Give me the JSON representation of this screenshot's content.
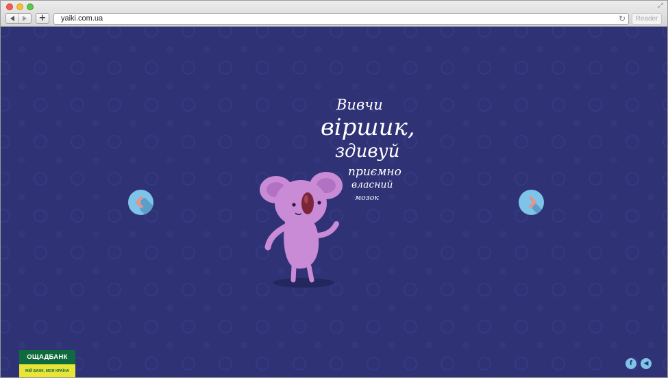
{
  "browser": {
    "url": "yaiki.com.ua",
    "reader_label": "Reader",
    "add_tab_label": "+",
    "reload_glyph": "↻",
    "fullscreen_glyph": "⤢"
  },
  "page": {
    "headline_lines": [
      "Вивчи",
      "віршик,",
      "здивуй",
      "приємно",
      "власний",
      "мозок"
    ],
    "bank_name": "ОЩАДБАНК",
    "bank_slogan": "МІЙ БАНК. МОЯ КРАЇНА",
    "facebook_glyph": "f",
    "sound_glyph": "◀"
  },
  "colors": {
    "background": "#2f3275",
    "accent_blue": "#7ec3e8",
    "koala_pink": "#c98ad6",
    "arrow_chevron": "#e6928e",
    "bank_green": "#0f6b3e",
    "bank_yellow": "#e9e536"
  }
}
